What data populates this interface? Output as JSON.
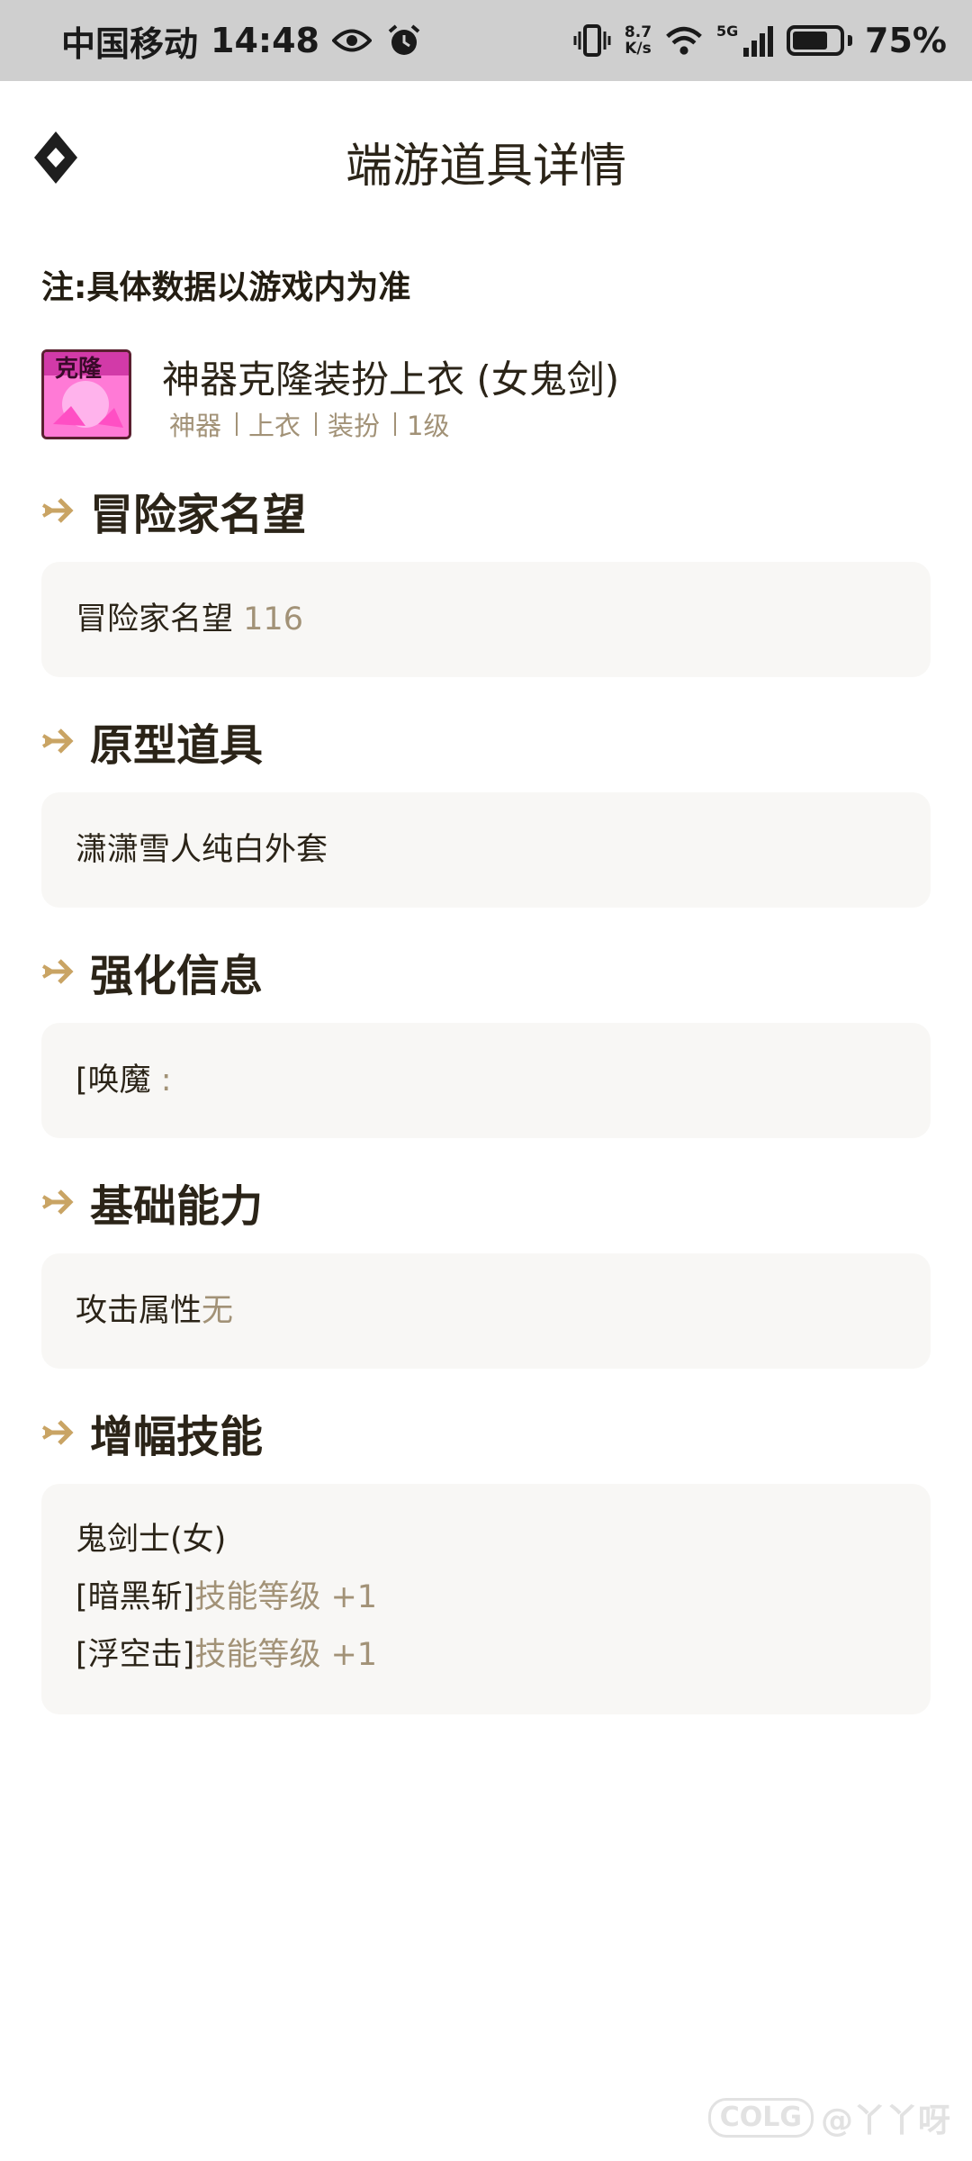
{
  "status_bar": {
    "carrier": "中国移动",
    "time": "14:48",
    "net_speed_value": "8.7",
    "net_speed_unit": "K/s",
    "network_type": "5G",
    "battery_level": 0.75,
    "battery_text": "75%",
    "icons": [
      "eye-icon",
      "alarm-icon",
      "vibrate-icon",
      "wifi-icon",
      "signal-icon",
      "battery-icon"
    ]
  },
  "header": {
    "title": "端游道具详情",
    "back_icon": "back-diamond-icon"
  },
  "note": "注:具体数据以游戏内为准",
  "item": {
    "name": "神器克隆装扮上衣 (女鬼剑)",
    "thumb_text": "克隆",
    "tags": [
      "神器",
      "上衣",
      "装扮",
      "1级"
    ]
  },
  "sections": {
    "reputation": {
      "title": "冒险家名望",
      "label": "冒险家名望",
      "value": "116"
    },
    "prototype": {
      "title": "原型道具",
      "value": "潇潇雪人纯白外套"
    },
    "enhance": {
      "title": "强化信息",
      "label": "[唤魔",
      "suffix": ":"
    },
    "basic": {
      "title": "基础能力",
      "label": "攻击属性",
      "value": "无"
    },
    "skills": {
      "title": "增幅技能",
      "class_name": "鬼剑士(女)",
      "rows": [
        {
          "skill": "[暗黑斩]",
          "effect": "技能等级 +1"
        },
        {
          "skill": "[浮空击]",
          "effect": "技能等级 +1"
        }
      ]
    }
  },
  "watermark": {
    "logo": "COLG",
    "user": "@丫丫呀"
  },
  "colors": {
    "accent": "#c9a464",
    "muted_text": "#a29277",
    "card_bg": "#f8f7f5",
    "status_bar_bg": "#cfcfcf"
  }
}
